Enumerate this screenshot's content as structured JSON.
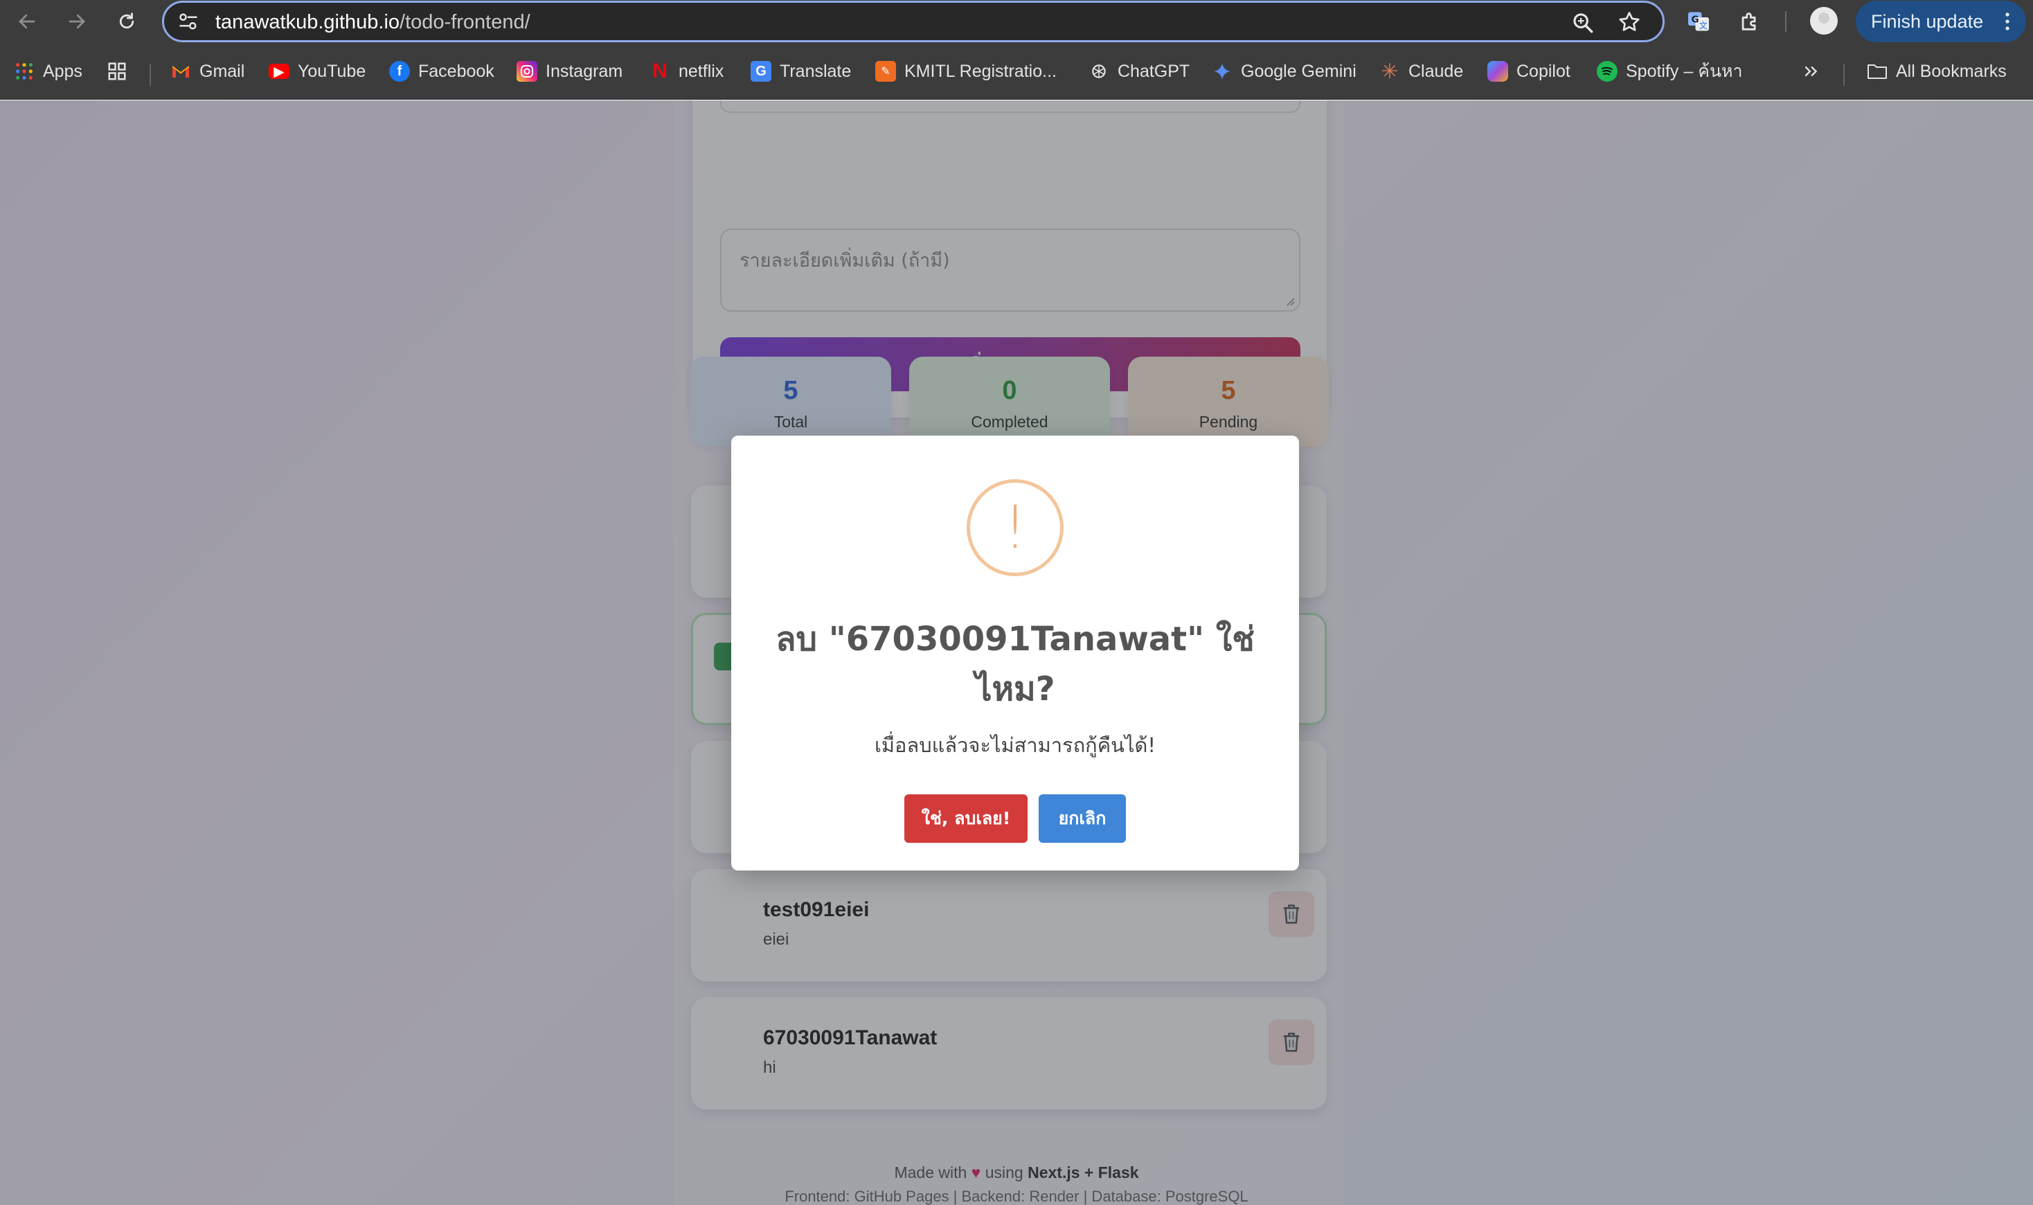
{
  "browser": {
    "url_host": "tanawatkub.github.io",
    "url_path": "/todo-frontend/",
    "finish_update_label": "Finish update",
    "bookmarks": [
      {
        "label": "Apps",
        "icon": "apps-grid-icon"
      },
      {
        "label": "Gmail",
        "icon": "gmail-icon"
      },
      {
        "label": "YouTube",
        "icon": "youtube-icon"
      },
      {
        "label": "Facebook",
        "icon": "facebook-icon"
      },
      {
        "label": "Instagram",
        "icon": "instagram-icon"
      },
      {
        "label": "netflix",
        "icon": "netflix-icon"
      },
      {
        "label": "Translate",
        "icon": "translate-icon"
      },
      {
        "label": "KMITL Registratio...",
        "icon": "kmitl-icon"
      },
      {
        "label": "ChatGPT",
        "icon": "chatgpt-icon"
      },
      {
        "label": "Google Gemini",
        "icon": "gemini-icon"
      },
      {
        "label": "Claude",
        "icon": "claude-icon"
      },
      {
        "label": "Copilot",
        "icon": "copilot-icon"
      },
      {
        "label": "Spotify – ค้นหา",
        "icon": "spotify-icon"
      }
    ],
    "all_bookmarks_label": "All Bookmarks"
  },
  "form": {
    "description_placeholder": "รายละเอียดเพิ่มเติม (ถ้ามี)",
    "add_button_label": "เพิ่มรายการ"
  },
  "stats": {
    "total": {
      "value": "5",
      "label": "Total"
    },
    "completed": {
      "value": "0",
      "label": "Completed"
    },
    "pending": {
      "value": "5",
      "label": "Pending"
    }
  },
  "tasks": [
    {
      "title": "test091eiei",
      "description": "eiei"
    },
    {
      "title": "67030091Tanawat",
      "description": "hi"
    }
  ],
  "footer": {
    "made_with": "Made with",
    "using": "using",
    "tech": "Next.js + Flask",
    "stack": "Frontend: GitHub Pages | Backend: Render | Database: PostgreSQL"
  },
  "modal": {
    "icon_symbol": "!",
    "title": "ลบ \"67030091Tanawat\" ใช่ไหม?",
    "text": "เมื่อลบแล้วจะไม่สามารถกู้คืนได้!",
    "confirm_label": "ใช่, ลบเลย!",
    "cancel_label": "ยกเลิก"
  },
  "colors": {
    "primary_gradient_start": "#7b3fe4",
    "primary_gradient_end": "#c8305a",
    "confirm_red": "#d33a3a",
    "cancel_blue": "#3f85d8",
    "warning_orange": "#f0b07a"
  }
}
